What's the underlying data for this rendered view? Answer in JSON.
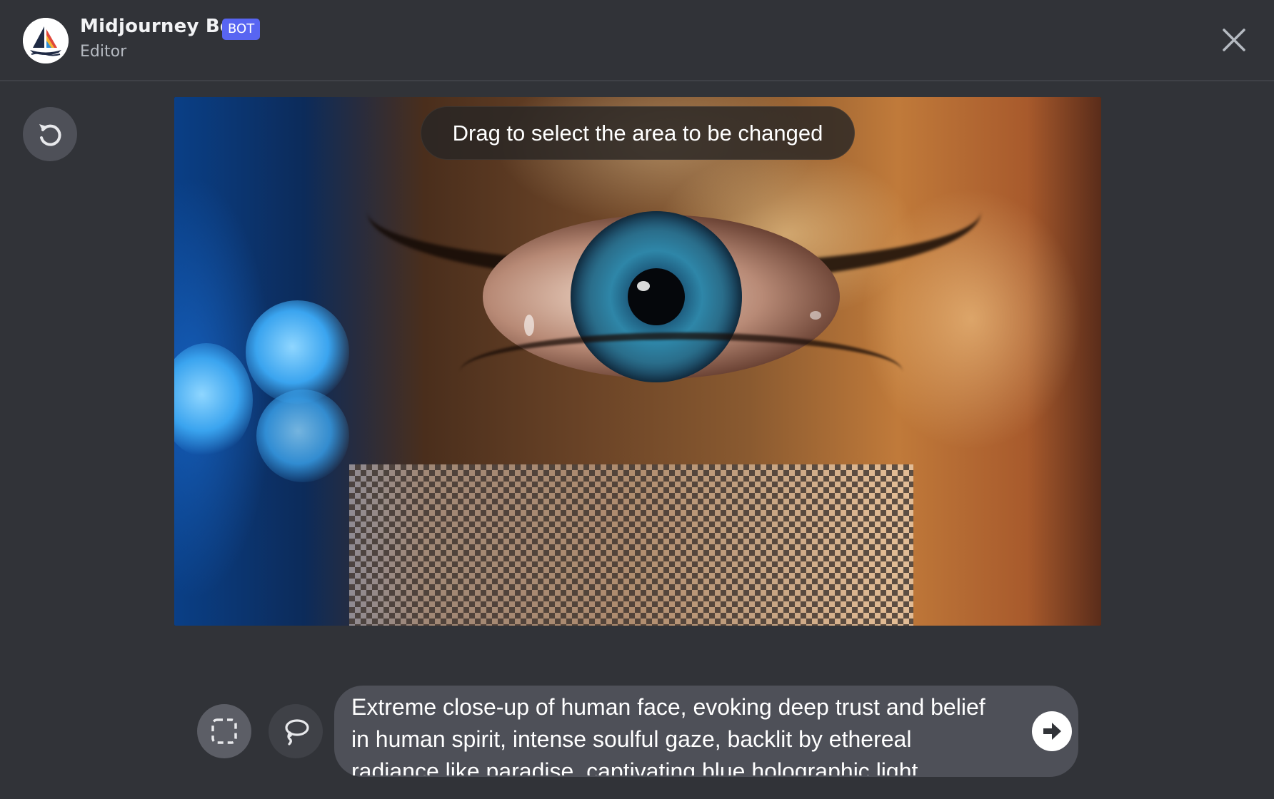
{
  "header": {
    "bot_name": "Midjourney Bot",
    "badge": "BOT",
    "subtitle": "Editor",
    "avatar_icon": "midjourney-sailboat-logo",
    "close_icon": "close-icon"
  },
  "editor": {
    "undo_icon": "undo-icon",
    "hint": "Drag to select the area to be changed",
    "image_description_hidden": ""
  },
  "tools": {
    "rectangle_icon": "rectangle-select-icon",
    "lasso_icon": "lasso-select-icon"
  },
  "prompt": {
    "text": "Extreme close-up of human face, evoking deep trust and belief in human spirit, intense soulful gaze, backlit by ethereal radiance like paradise, captivating blue holographic light particles. Hyper",
    "submit_icon": "submit-arrow-icon"
  },
  "colors": {
    "background": "#313338",
    "badge": "#5865f2",
    "button": "#4e5058"
  }
}
